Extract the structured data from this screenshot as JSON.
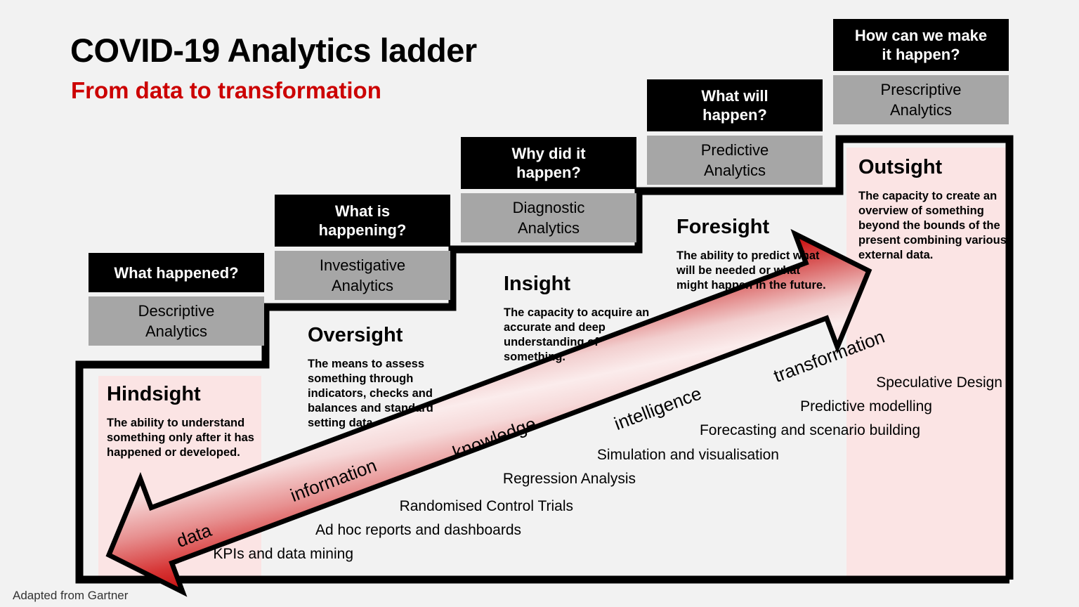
{
  "title": {
    "main": "COVID-19 Analytics ladder",
    "sub": "From data to transformation"
  },
  "colors": {
    "accent_red": "#cc0000",
    "question_box": "#000000",
    "answer_box": "#a6a6a6",
    "band_pink": "#fbe4e4",
    "background": "#f2f2f2"
  },
  "steps": [
    {
      "question": "What happened?",
      "answer_line1": "Descriptive",
      "answer_line2": "Analytics"
    },
    {
      "question_line1": "What is",
      "question_line2": "happening?",
      "answer_line1": "Investigative",
      "answer_line2": "Analytics"
    },
    {
      "question_line1": "Why did it",
      "question_line2": "happen?",
      "answer_line1": "Diagnostic",
      "answer_line2": "Analytics"
    },
    {
      "question_line1": "What will",
      "question_line2": "happen?",
      "answer_line1": "Predictive",
      "answer_line2": "Analytics"
    },
    {
      "question_line1": "How can we make",
      "question_line2": "it happen?",
      "answer_line1": "Prescriptive",
      "answer_line2": "Analytics"
    }
  ],
  "sights": [
    {
      "name": "Hindsight",
      "description": "The ability to understand something only after it has happened or developed."
    },
    {
      "name": "Oversight",
      "description": "The means to assess something through indicators, checks and balances and standard setting data."
    },
    {
      "name": "Insight",
      "description": "The capacity to acquire an accurate and deep understanding of something."
    },
    {
      "name": "Foresight",
      "description": "The ability to predict what will be needed or what might happen in the future."
    },
    {
      "name": "Outsight",
      "description": "The capacity to create an overview of something beyond the bounds of the present combining various external data."
    }
  ],
  "arrow_labels": [
    "data",
    "information",
    "knowledge",
    "intelligence",
    "transformation"
  ],
  "techniques": [
    "KPIs and data mining",
    "Ad hoc reports and dashboards",
    "Randomised Control Trials",
    "Regression Analysis",
    "Simulation and visualisation",
    "Forecasting and scenario building",
    "Predictive modelling",
    "Speculative Design"
  ],
  "footer": "Adapted from Gartner"
}
